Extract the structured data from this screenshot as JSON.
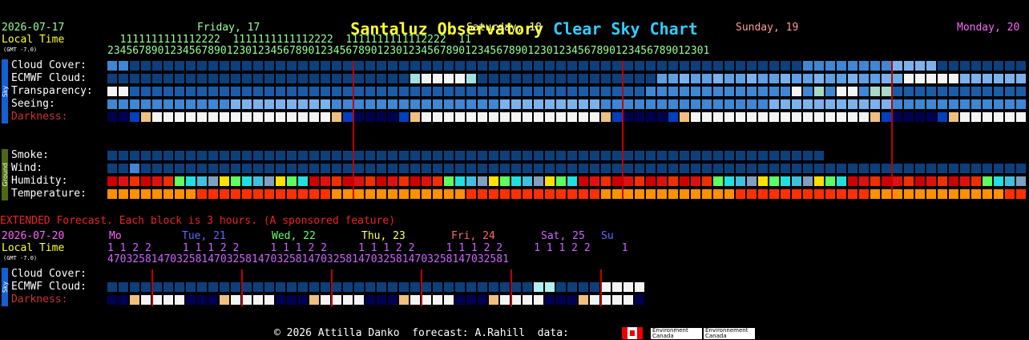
{
  "title": {
    "part1": "Santaluz Observatory",
    "part2": "Clear Sky Chart"
  },
  "main": {
    "date": "2026-07-17",
    "local_time_label": "Local Time",
    "gmt_label": "(GMT -7.0)",
    "days": [
      {
        "label": "Friday, 17",
        "color": "#9f9"
      },
      {
        "label": "Saturday, 18",
        "color": "#ff9"
      },
      {
        "label": "Sunday, 19",
        "color": "#f99"
      },
      {
        "label": "Monday, 20",
        "color": "#f6f"
      }
    ],
    "hours_tens": "  1111111111112222  1111111111112222  1111111111112222  11",
    "hours_ones": "234567890123456789012301234567890123456789012301234567890123456789012301234567890123456789012301",
    "sky_side": "Sky",
    "ground_side": "Ground",
    "rows": [
      {
        "label": "Cloud Cover:"
      },
      {
        "label": "ECMWF Cloud:"
      },
      {
        "label": "Transparency:"
      },
      {
        "label": "Seeing:"
      },
      {
        "label": "Darkness:",
        "color": "#c33"
      },
      {
        "label": "Smoke:"
      },
      {
        "label": "Wind:"
      },
      {
        "label": "Humidity:"
      },
      {
        "label": "Temperature:"
      }
    ]
  },
  "extended": {
    "heading": "EXTENDED Forecast. Each block is 3 hours. (A sponsored feature)",
    "date": "2026-07-20",
    "local_time_label": "Local Time",
    "gmt_label": "(GMT -7.0)",
    "days": [
      {
        "label": "Mo",
        "color": "#f6f"
      },
      {
        "label": "Tue, 21",
        "color": "#66f"
      },
      {
        "label": "Wed, 22",
        "color": "#6f6"
      },
      {
        "label": "Thu, 23",
        "color": "#ff6"
      },
      {
        "label": "Fri, 24",
        "color": "#f66"
      },
      {
        "label": "Sat, 25",
        "color": "#c6f"
      },
      {
        "label": "Su",
        "color": "#66f"
      }
    ],
    "hours_tens": "1 1 2 2     1 1 1 2 2     1 1 1 2 2     1 1 1 2 2     1 1 1 2 2     1 1 1 2 2     1",
    "hours_ones": "4703258147032581470325814703258147032581470325814703258147032581",
    "sky_side": "Sky",
    "rows": [
      {
        "label": "Cloud Cover:"
      },
      {
        "label": "ECMWF Cloud:"
      },
      {
        "label": "Darkness:",
        "color": "#c33"
      }
    ]
  },
  "footer": {
    "copyright": "© 2026 Attilla Danko  forecast: A.Rahill  data:",
    "logo1": "Environment Canada",
    "logo2": "Environnement Canada"
  }
}
